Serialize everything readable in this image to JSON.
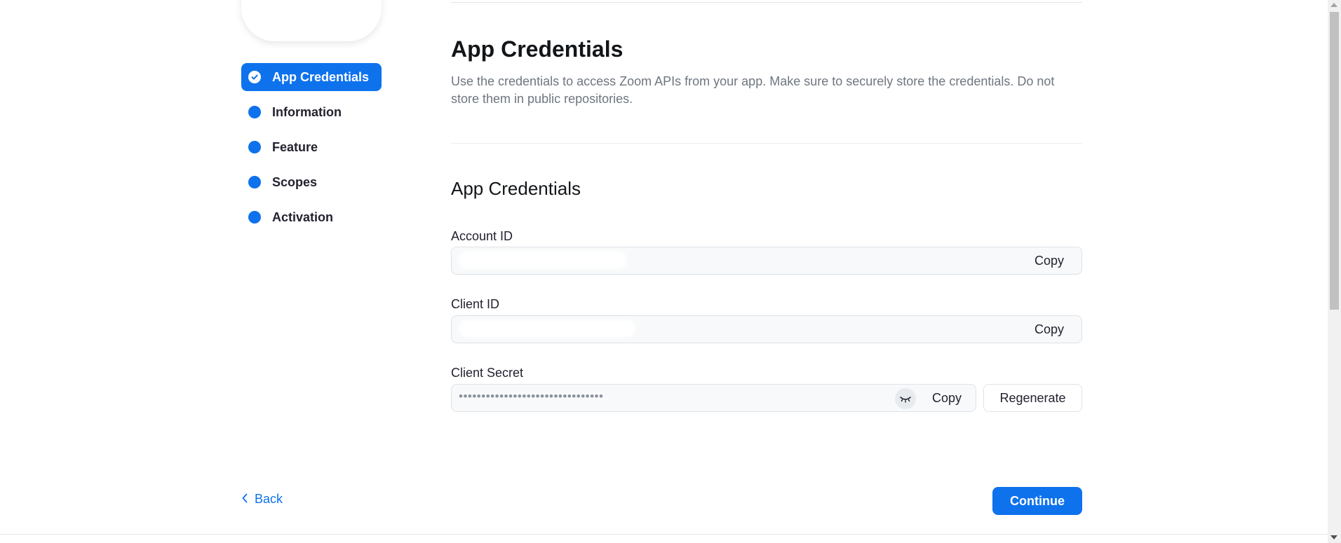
{
  "nav": {
    "items": [
      {
        "label": "App Credentials",
        "active": true
      },
      {
        "label": "Information",
        "active": false
      },
      {
        "label": "Feature",
        "active": false
      },
      {
        "label": "Scopes",
        "active": false
      },
      {
        "label": "Activation",
        "active": false
      }
    ]
  },
  "main": {
    "title": "App Credentials",
    "description": "Use the credentials to access Zoom APIs from your app. Make sure to securely store the credentials. Do not store them in public repositories.",
    "section_title": "App Credentials",
    "fields": {
      "account_id": {
        "label": "Account ID",
        "value": "",
        "copy_label": "Copy"
      },
      "client_id": {
        "label": "Client ID",
        "value": "",
        "copy_label": "Copy"
      },
      "client_secret": {
        "label": "Client Secret",
        "value": "••••••••••••••••••••••••••••••••",
        "copy_label": "Copy",
        "regenerate_label": "Regenerate"
      }
    }
  },
  "footer": {
    "back_label": "Back",
    "continue_label": "Continue"
  },
  "colors": {
    "accent": "#0e72ed",
    "text": "#222230",
    "muted": "#6e7680"
  },
  "icons": {
    "active_step": "check-circle-icon",
    "inactive_step": "dot-icon",
    "reveal": "eye-closed-icon",
    "back": "chevron-left-icon"
  }
}
